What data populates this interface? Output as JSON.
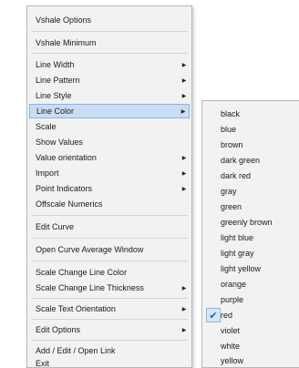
{
  "context_menu": {
    "items": [
      {
        "label": "Vshale Options",
        "has_submenu": false
      },
      {
        "label": "Vshale Minimum",
        "has_submenu": false
      },
      {
        "label": "Line Width",
        "has_submenu": true
      },
      {
        "label": "Line Pattern",
        "has_submenu": true
      },
      {
        "label": "Line Style",
        "has_submenu": true
      },
      {
        "label": "Line Color",
        "has_submenu": true,
        "highlighted": true
      },
      {
        "label": "Scale",
        "has_submenu": false
      },
      {
        "label": "Show Values",
        "has_submenu": false
      },
      {
        "label": "Value orientation",
        "has_submenu": true
      },
      {
        "label": "Import",
        "has_submenu": true
      },
      {
        "label": "Point Indicators",
        "has_submenu": true
      },
      {
        "label": "Offscale Numerics",
        "has_submenu": false
      },
      {
        "label": "Edit Curve",
        "has_submenu": false
      },
      {
        "label": "Open Curve Average Window",
        "has_submenu": false
      },
      {
        "label": "Scale Change Line Color",
        "has_submenu": false
      },
      {
        "label": "Scale Change Line Thickness",
        "has_submenu": true
      },
      {
        "label": "Scale Text Orientation",
        "has_submenu": true
      },
      {
        "label": "Edit Options",
        "has_submenu": true
      },
      {
        "label": "Add / Edit / Open Link",
        "has_submenu": false
      },
      {
        "label": "Exit",
        "has_submenu": false
      }
    ],
    "arrow_glyph": "▶"
  },
  "color_submenu": {
    "items": [
      {
        "label": "black"
      },
      {
        "label": "blue"
      },
      {
        "label": "brown"
      },
      {
        "label": "dark green"
      },
      {
        "label": "dark red"
      },
      {
        "label": "gray"
      },
      {
        "label": "green"
      },
      {
        "label": "greenly brown"
      },
      {
        "label": "light blue"
      },
      {
        "label": "light gray"
      },
      {
        "label": "light yellow"
      },
      {
        "label": "orange"
      },
      {
        "label": "purple"
      },
      {
        "label": "red",
        "checked": true
      },
      {
        "label": "violet"
      },
      {
        "label": "white"
      },
      {
        "label": "yellow"
      }
    ],
    "check_glyph": "✔"
  },
  "colors": {
    "highlight_bg": "#c9def5",
    "highlight_border": "#86b3e5",
    "check": "#1b5fc2"
  }
}
